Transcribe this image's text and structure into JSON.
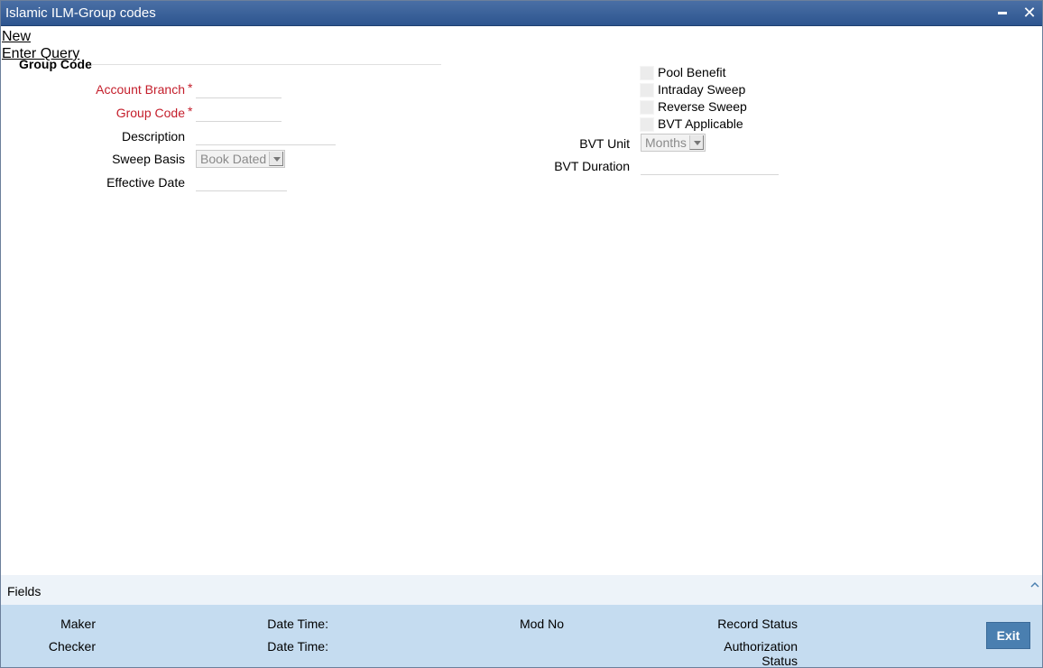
{
  "window": {
    "title": "Islamic ILM-Group codes",
    "minimize_icon": "minimize-icon",
    "close_icon": "close-icon",
    "close_glyph": "✕"
  },
  "toolbar": {
    "new_label": "New",
    "enter_query_label": "Enter Query"
  },
  "section": {
    "title": "Group Code"
  },
  "form": {
    "account_branch": {
      "label": "Account Branch",
      "value": ""
    },
    "group_code": {
      "label": "Group Code",
      "value": ""
    },
    "description": {
      "label": "Description",
      "value": ""
    },
    "sweep_basis": {
      "label": "Sweep Basis",
      "value": "Book Dated"
    },
    "effective_date": {
      "label": "Effective Date",
      "value": ""
    },
    "required_marker": "*"
  },
  "options": {
    "pool_benefit": "Pool Benefit",
    "intraday_sweep": "Intraday Sweep",
    "reverse_sweep": "Reverse Sweep",
    "bvt_applicable": "BVT Applicable",
    "bvt_unit": {
      "label": "BVT Unit",
      "value": "Months"
    },
    "bvt_duration": {
      "label": "BVT Duration",
      "value": ""
    }
  },
  "fields_bar": {
    "label": "Fields",
    "collapse_icon": "chevron-up-icon"
  },
  "footer": {
    "maker": "Maker",
    "checker": "Checker",
    "date_time": "Date Time:",
    "mod_no": "Mod No",
    "record_status": "Record Status",
    "authorization_status_1": "Authorization",
    "authorization_status_2": "Status",
    "exit_label": "Exit"
  },
  "colors": {
    "title_bar": "#2d558f",
    "required": "#c41e2b",
    "footer_bg": "#c5dcf0",
    "exit_button": "#4a7fb0"
  }
}
